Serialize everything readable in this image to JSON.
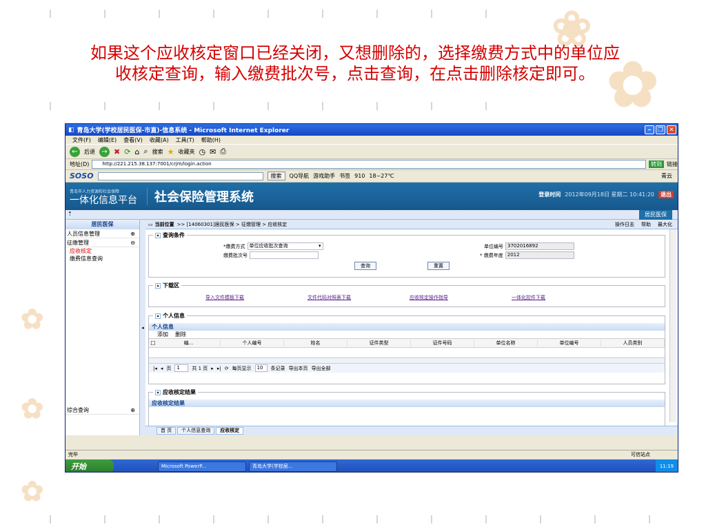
{
  "caption": {
    "line1": "如果这个应收核定窗口已经关闭，又想删除的，选择缴费方式中的单位应",
    "line2": "收核定查询，输入缴费批次号，点击查询，在点击删除核定即可。"
  },
  "window": {
    "title": "青岛大学(学校居民医保-市直)-信息系统 - Microsoft Internet Explorer",
    "menu": [
      "文件(F)",
      "编辑(E)",
      "查看(V)",
      "收藏(A)",
      "工具(T)",
      "帮助(H)"
    ],
    "toolbar": {
      "back": "后退",
      "search": "搜索",
      "favorites": "收藏夹"
    },
    "address_label": "地址(D)",
    "address": "http://221.215.38.137:7001/crjm/login.action",
    "go": "转到",
    "links": "链接"
  },
  "soso": {
    "logo": "SOSO",
    "search_btn": "搜索",
    "items": [
      "QQ导航",
      "游戏助手",
      "书签",
      "910",
      "18~27℃"
    ],
    "right": "青云"
  },
  "app": {
    "logo_small": "青岛市人力资源和社会保障",
    "logo_big": "一体化信息平台",
    "system_title": "社会保险管理系统",
    "login_label": "登录时间",
    "login_time": "2012年09月18日 星期二 10:41:20",
    "exit": "退出",
    "module_tab": "居民医保"
  },
  "sidebar": {
    "header": "居民医保",
    "items": [
      "人员信息管理",
      "征缴管理",
      "综合查询"
    ],
    "subs": [
      "应收核定",
      "缴费信息查询"
    ]
  },
  "breadcrumb": {
    "label": "当前位置",
    "path": ">> [14060301]居民医保 > 征缴管理 > 应收核定",
    "log": "操作日志",
    "help": "帮助",
    "max": "最大化"
  },
  "query": {
    "legend": "查询条件",
    "pay_method_label": "*缴费方式",
    "pay_method_value": "单位应收批次查询",
    "batch_label": "缴费批次号",
    "unit_no_label": "单位编号",
    "unit_no_value": "3702016892",
    "year_label": "* 缴费年度",
    "year_value": "2012",
    "query_btn": "查询",
    "reset_btn": "重置"
  },
  "download": {
    "legend": "下载区",
    "links": [
      "导入文件模板下载",
      "文件代码对照表下载",
      "应收核定操作指导",
      "一体化控件下载"
    ]
  },
  "person": {
    "legend": "个人信息",
    "grid_title": "个人信息",
    "add": "添加",
    "delete": "删除",
    "columns": [
      "编...",
      "个人编号",
      "姓名",
      "证件类型",
      "证件号码",
      "单位名称",
      "单位编号",
      "人员类别"
    ],
    "pager": {
      "page": "页",
      "page_value": "1",
      "of": "共 1 页",
      "per_page": "每页显示",
      "per_page_value": "10",
      "records": "条记录",
      "export_page": "导出本页",
      "export_all": "导出全部"
    }
  },
  "result": {
    "legend": "应收核定结果",
    "grid_title": "应收核定结果"
  },
  "tabs": [
    "首 页",
    "个人信息查询",
    "应收核定"
  ],
  "status": {
    "left": "完毕",
    "right": "可信站点"
  },
  "taskbar": {
    "start": "开始",
    "items": [
      "Microsoft PowerP...",
      "青岛大学(学校居..."
    ],
    "time": "11:19"
  }
}
